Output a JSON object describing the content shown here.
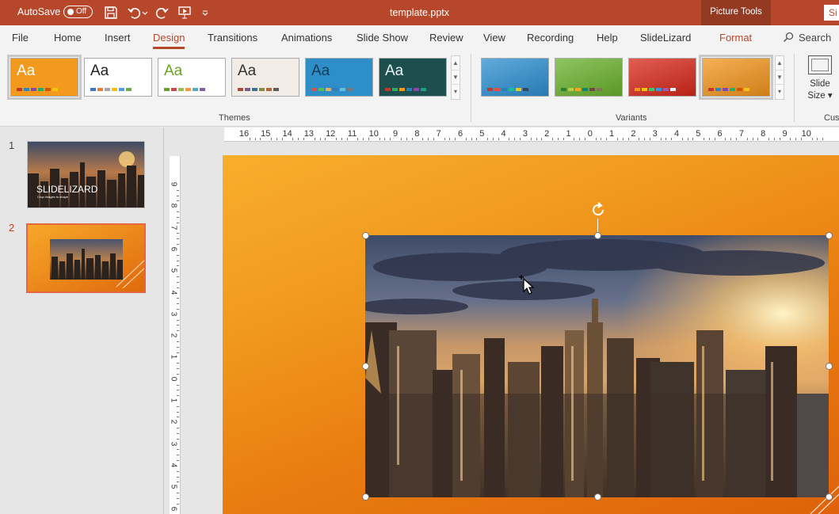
{
  "titlebar": {
    "autosave_label": "AutoSave",
    "autosave_state": "Off",
    "filename": "template.pptx",
    "context_tab": "Picture Tools",
    "signin_label": "Si"
  },
  "tabs": [
    "File",
    "Home",
    "Insert",
    "Design",
    "Transitions",
    "Animations",
    "Slide Show",
    "Review",
    "View",
    "Recording",
    "Help",
    "SlideLizard",
    "Format"
  ],
  "active_tab": "Design",
  "search_label": "Search",
  "ribbon": {
    "themes_label": "Themes",
    "variants_label": "Variants",
    "customize_label": "Cus",
    "slide_size_line1": "Slide",
    "slide_size_line2": "Size",
    "themes": [
      {
        "label": "Aa",
        "bg": "#f39a1e",
        "fg": "#ffffff",
        "bars": [
          "#c0392b",
          "#2e86c1",
          "#8e44ad",
          "#27ae60",
          "#d35400",
          "#f1c40f"
        ]
      },
      {
        "label": "Aa",
        "bg": "#ffffff",
        "fg": "#222222",
        "bars": [
          "#4472c4",
          "#ed7d31",
          "#a5a5a5",
          "#ffc000",
          "#5b9bd5",
          "#70ad47"
        ]
      },
      {
        "label": "Aa",
        "bg": "#ffffff",
        "fg": "#6aa121",
        "bars": [
          "#6aa121",
          "#c0504d",
          "#9bbb59",
          "#f79646",
          "#4bacc6",
          "#8064a2"
        ]
      },
      {
        "label": "Aa",
        "bg": "#f1ece6",
        "fg": "#333333",
        "bars": [
          "#a04f3c",
          "#7a5c8c",
          "#3f6f8f",
          "#8a8a3c",
          "#b06a3a",
          "#5e5e5e"
        ]
      },
      {
        "label": "Aa",
        "bg": "#2e8fc8",
        "fg": "#173b5a",
        "bars": [
          "#d9534f",
          "#5cb85c",
          "#f0ad4e",
          "#337ab7",
          "#5bc0de",
          "#777777"
        ]
      },
      {
        "label": "Aa",
        "bg": "#1e4f4f",
        "fg": "#e8f3f3",
        "bars": [
          "#c0392b",
          "#27ae60",
          "#f39c12",
          "#2980b9",
          "#8e44ad",
          "#16a085"
        ]
      }
    ],
    "variants": [
      {
        "bg": "#2c8fd1",
        "bars": [
          "#c0392b",
          "#e74c3c",
          "#2980b9",
          "#1abc9c",
          "#f1c40f",
          "#34495e"
        ]
      },
      {
        "bg": "#6ab22c",
        "bars": [
          "#2e7d32",
          "#c0ca33",
          "#f9a825",
          "#00897b",
          "#6d4c41",
          "#8d6e63"
        ]
      },
      {
        "bg": "#d8281a",
        "bars": [
          "#f39c12",
          "#f1c40f",
          "#2ecc71",
          "#3498db",
          "#9b59b6",
          "#ecf0f1"
        ]
      },
      {
        "bg": "#f2951c",
        "bars": [
          "#c0392b",
          "#2e86c1",
          "#8e44ad",
          "#27ae60",
          "#d35400",
          "#f1c40f"
        ]
      }
    ]
  },
  "slides": [
    {
      "number": "1",
      "title": "SLIDELIZARD",
      "subtitle": "Crop images to shape"
    },
    {
      "number": "2"
    }
  ],
  "rulers": {
    "horizontal": [
      "16",
      "15",
      "14",
      "13",
      "12",
      "11",
      "10",
      "9",
      "8",
      "7",
      "6",
      "5",
      "4",
      "3",
      "2",
      "1",
      "0",
      "1",
      "2",
      "3",
      "4",
      "5",
      "6",
      "7",
      "8",
      "9",
      "10"
    ],
    "vertical": [
      "9",
      "8",
      "7",
      "6",
      "5",
      "4",
      "3",
      "2",
      "1",
      "0",
      "1",
      "2",
      "3",
      "4",
      "5",
      "6"
    ]
  },
  "colors": {
    "accent": "#b7472a",
    "slide_orange": "#f19a1e"
  }
}
